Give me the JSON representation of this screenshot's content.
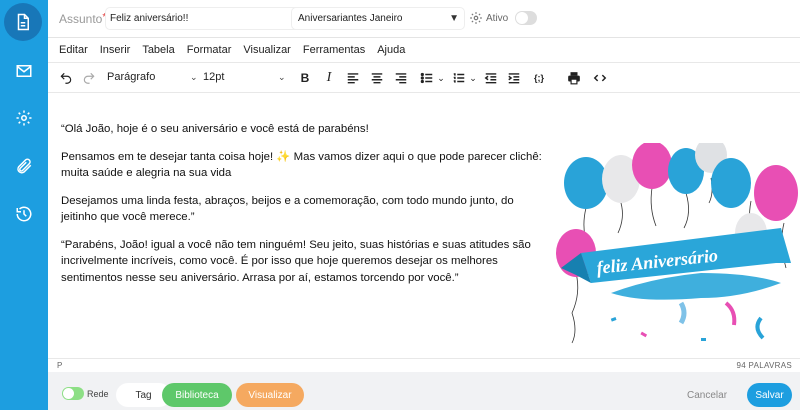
{
  "subject": {
    "label": "Assunto",
    "required_mark": "*",
    "value": "Feliz aniversário!!",
    "list_selected": "Aniversariantes Janeiro",
    "status_label": "Ativo"
  },
  "sidebar": {
    "items": [
      {
        "icon": "document-icon",
        "active": true
      },
      {
        "icon": "mail-icon",
        "active": false
      },
      {
        "icon": "gear-icon",
        "active": false
      },
      {
        "icon": "paperclip-icon",
        "active": false
      },
      {
        "icon": "history-icon",
        "active": false
      }
    ]
  },
  "menubar": {
    "items": [
      "Editar",
      "Inserir",
      "Tabela",
      "Formatar",
      "Visualizar",
      "Ferramentas",
      "Ajuda"
    ]
  },
  "toolbar": {
    "block_format": "Parágrafo",
    "font_size": "12pt",
    "bold": "B",
    "italic": "I",
    "code_sample": "{;}"
  },
  "content": {
    "paragraphs": [
      " “Olá João, hoje é o seu aniversário e você está de parabéns!",
      "Pensamos em te desejar tanta coisa hoje! ✨ Mas vamos dizer aqui o que pode parecer clichê: muita saúde e alegria na sua vida",
      "Desejamos uma linda festa, abraços, beijos e a comemoração, com todo mundo junto, do jeitinho que você merece.”",
      "“Parabéns, João! igual a você não tem ninguém! Seu jeito, suas histórias e suas atitudes são incrivelmente incríveis, como você. É por isso que hoje queremos desejar os melhores sentimentos nesse seu aniversário. Arrasa por aí, estamos torcendo por você.”"
    ],
    "image_banner_text": "feliz Aniversário"
  },
  "statusbar": {
    "path": "P",
    "word_count": "94 PALAVRAS"
  },
  "bottom": {
    "rede_label": "Rede",
    "tag_label": "Tag",
    "biblioteca_label": "Biblioteca",
    "visualizar_label": "Visualizar",
    "cancel_label": "Cancelar",
    "save_label": "Salvar"
  },
  "colors": {
    "sidebar": "#1d9ee0",
    "sidebar_active": "#1877b8",
    "biblioteca": "#5ec86a",
    "visualizar": "#f5a960",
    "save": "#1d9ee0",
    "toggle_on": "#8ddf85"
  }
}
